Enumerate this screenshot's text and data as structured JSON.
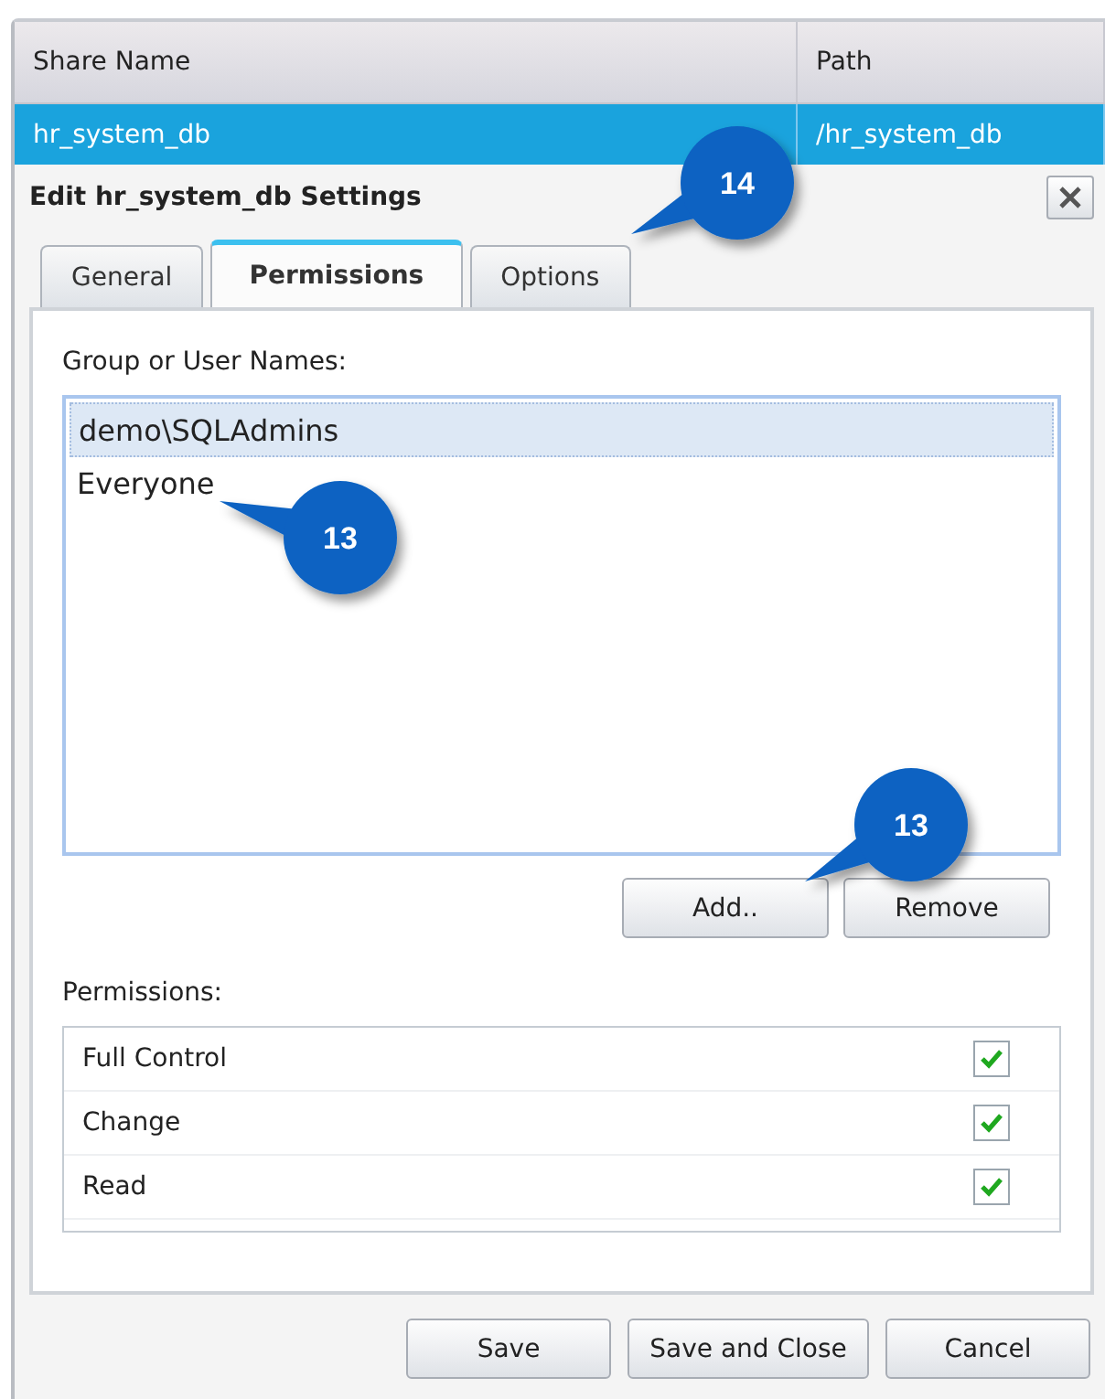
{
  "table": {
    "columns": [
      "Share Name",
      "Path"
    ],
    "rows": [
      {
        "cells": [
          "hr_system_db",
          "/hr_system_db"
        ],
        "selected": true
      }
    ]
  },
  "dialog": {
    "title": "Edit hr_system_db Settings",
    "tabs": [
      {
        "label": "General",
        "selected": false
      },
      {
        "label": "Permissions",
        "selected": true
      },
      {
        "label": "Options",
        "selected": false
      }
    ],
    "group_label": "Group or User Names:",
    "names": [
      {
        "label": "demo\\SQLAdmins",
        "selected": true
      },
      {
        "label": "Everyone",
        "selected": false
      }
    ],
    "list_buttons": [
      "Add..",
      "Remove"
    ],
    "permissions_label": "Permissions:",
    "permissions": [
      {
        "label": "Full Control",
        "checked": true
      },
      {
        "label": "Change",
        "checked": true
      },
      {
        "label": "Read",
        "checked": true
      }
    ],
    "footer_buttons": [
      "Save",
      "Save and Close",
      "Cancel"
    ]
  },
  "callouts": [
    {
      "label": "14"
    },
    {
      "label": "13"
    },
    {
      "label": "13"
    }
  ]
}
